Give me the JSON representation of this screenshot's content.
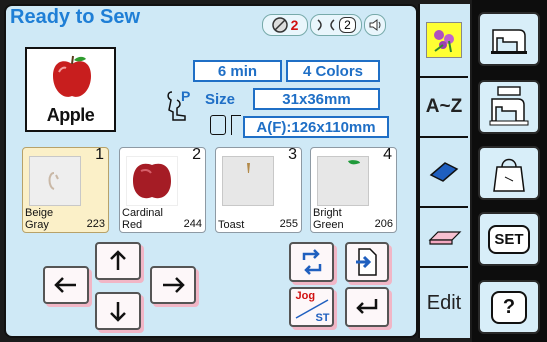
{
  "header": {
    "title": "Ready to Sew",
    "bobbin_count": "2",
    "tension_count": "2"
  },
  "design": {
    "name": "Apple",
    "time": "6 min",
    "colors": "4 Colors",
    "size_label": "Size",
    "presser_foot": "P",
    "size": "31x36mm",
    "hoop": "A(F):126x110mm"
  },
  "threads": [
    {
      "num": "1",
      "name_line1": "Beige",
      "name_line2": "Gray",
      "code": "223",
      "swatch": "#e6dcc4"
    },
    {
      "num": "2",
      "name_line1": "Cardinal",
      "name_line2": "Red",
      "code": "244",
      "swatch": "#a51c25"
    },
    {
      "num": "3",
      "name_line1": "Toast",
      "name_line2": "",
      "code": "255",
      "swatch": "#b38a4a"
    },
    {
      "num": "4",
      "name_line1": "Bright",
      "name_line2": "Green",
      "code": "206",
      "swatch": "#1f9a3a"
    }
  ],
  "controls": {
    "jog_label": "Jog",
    "st_label": "ST"
  },
  "tabs": {
    "az_label": "A~Z",
    "edit_label": "Edit"
  },
  "sidebar": {
    "set_label": "SET",
    "help_label": "?"
  },
  "colors": {
    "accent": "#1f7fd6",
    "panel": "#cfe9f6",
    "button_shadow": "#f1b6c6",
    "highlight_tab": "#ffff33"
  }
}
